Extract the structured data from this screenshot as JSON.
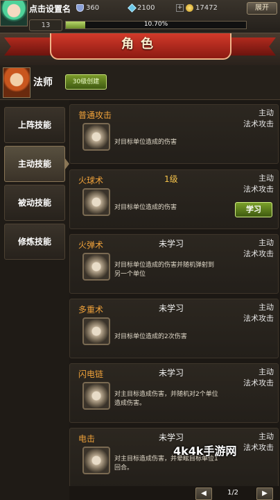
{
  "topbar": {
    "player_name": "点击设置名",
    "shield_value": "360",
    "gem_value": "2100",
    "coin_value": "17472",
    "plus_label": "+",
    "expand_label": "展开",
    "level": "13",
    "xp_text": "10.70%",
    "xp_progress": 0.107
  },
  "banner": {
    "title": "角色"
  },
  "hero": {
    "class_name": "法师",
    "create_label": "30级创建"
  },
  "tabs": [
    {
      "label": "上阵技能",
      "active": false
    },
    {
      "label": "主动技能",
      "active": true
    },
    {
      "label": "被动技能",
      "active": false
    },
    {
      "label": "修炼技能",
      "active": false
    }
  ],
  "skills": [
    {
      "name": "普通攻击",
      "status": "",
      "type_line1": "主动",
      "type_line2": "法术攻击",
      "desc": "对目标单位造成的伤害",
      "note": "",
      "action": ""
    },
    {
      "name": "火球术",
      "status": "1级",
      "type_line1": "主动",
      "type_line2": "法术攻击",
      "desc": "对目标单位造成的伤害",
      "note": "",
      "action": "学习"
    },
    {
      "name": "火弹术",
      "status": "未学习",
      "type_line1": "主动",
      "type_line2": "法术攻击",
      "desc": "对目标单位造成的伤害并随机弹射到另一个单位",
      "note": "",
      "action": ""
    },
    {
      "name": "多重术",
      "status": "未学习",
      "type_line1": "主动",
      "type_line2": "法术攻击",
      "desc": "对目标单位造成的2次伤害",
      "note": "",
      "action": ""
    },
    {
      "name": "闪电链",
      "status": "未学习",
      "type_line1": "主动",
      "type_line2": "法术攻击",
      "desc": "对主目标造成伤害，并随机对2个单位造成伤害。",
      "note": "",
      "action": ""
    },
    {
      "name": "电击",
      "status": "未学习",
      "type_line1": "主动",
      "type_line2": "法术攻击",
      "desc": "对主目标造成伤害，并晕眩目标单位1回合。",
      "note": "",
      "action": ""
    }
  ],
  "pager": {
    "prev_label": "◀",
    "next_label": "▶",
    "page": "1/2"
  },
  "watermark": "4k4k手游网",
  "colors": {
    "accent_orange": "#f0a23a",
    "learn_green": "#7aa02a",
    "banner_red": "#d23a2a"
  }
}
